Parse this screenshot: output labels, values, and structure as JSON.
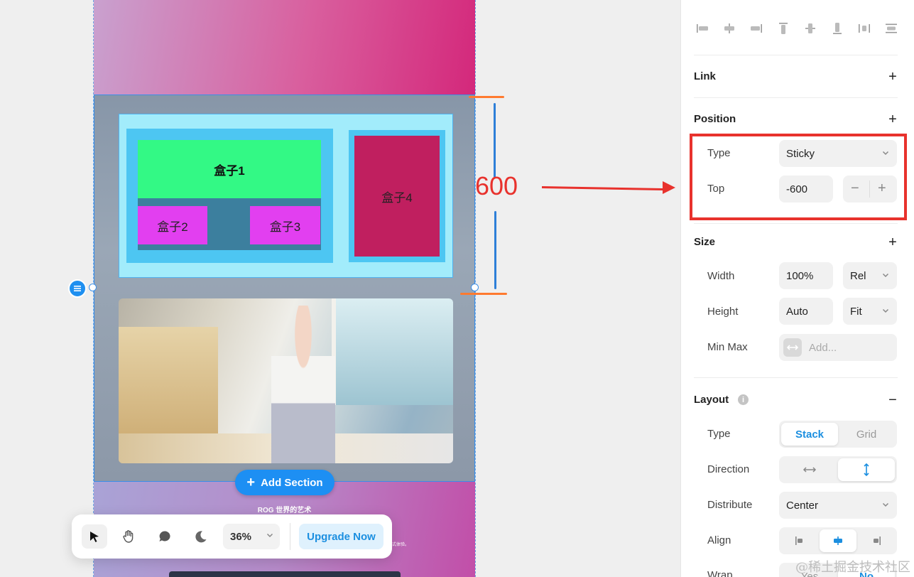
{
  "canvas": {
    "boxes": {
      "box1": "盒子1",
      "box2": "盒子2",
      "box3": "盒子3",
      "box4": "盒子4"
    },
    "annotation": {
      "value": "600"
    },
    "add_section_label": "Add Section",
    "rog_title": "ROG 世界的艺术",
    "tiny_text": "沉浸式体验。"
  },
  "toolbar": {
    "tools": [
      "pointer-icon",
      "hand-icon",
      "comment-icon",
      "moon-icon"
    ],
    "zoom": "36%",
    "upgrade_label": "Upgrade Now"
  },
  "panel": {
    "link": {
      "title": "Link",
      "action": "+"
    },
    "position": {
      "title": "Position",
      "action": "+",
      "type_label": "Type",
      "type_value": "Sticky",
      "top_label": "Top",
      "top_value": "-600",
      "minus": "−",
      "plus": "+"
    },
    "size": {
      "title": "Size",
      "action": "+",
      "width_label": "Width",
      "width_value": "100%",
      "width_unit": "Rel",
      "height_label": "Height",
      "height_value": "Auto",
      "height_unit": "Fit",
      "minmax_label": "Min Max",
      "minmax_placeholder": "Add..."
    },
    "layout": {
      "title": "Layout",
      "action": "−",
      "info": "i",
      "type_label": "Type",
      "type_options": [
        "Stack",
        "Grid"
      ],
      "type_selected": "Stack",
      "direction_label": "Direction",
      "direction_selected": "vertical",
      "distribute_label": "Distribute",
      "distribute_value": "Center",
      "align_label": "Align",
      "align_selected": "center",
      "wrap_label": "Wrap",
      "wrap_options": [
        "Yes",
        "No"
      ]
    }
  },
  "watermark": "@稀土掘金技术社区",
  "colors": {
    "accent": "#1c8fe0",
    "annotation_red": "#e8322d",
    "box1": "#33f985",
    "box2": "#e23ff0",
    "box4": "#c01f5f"
  }
}
